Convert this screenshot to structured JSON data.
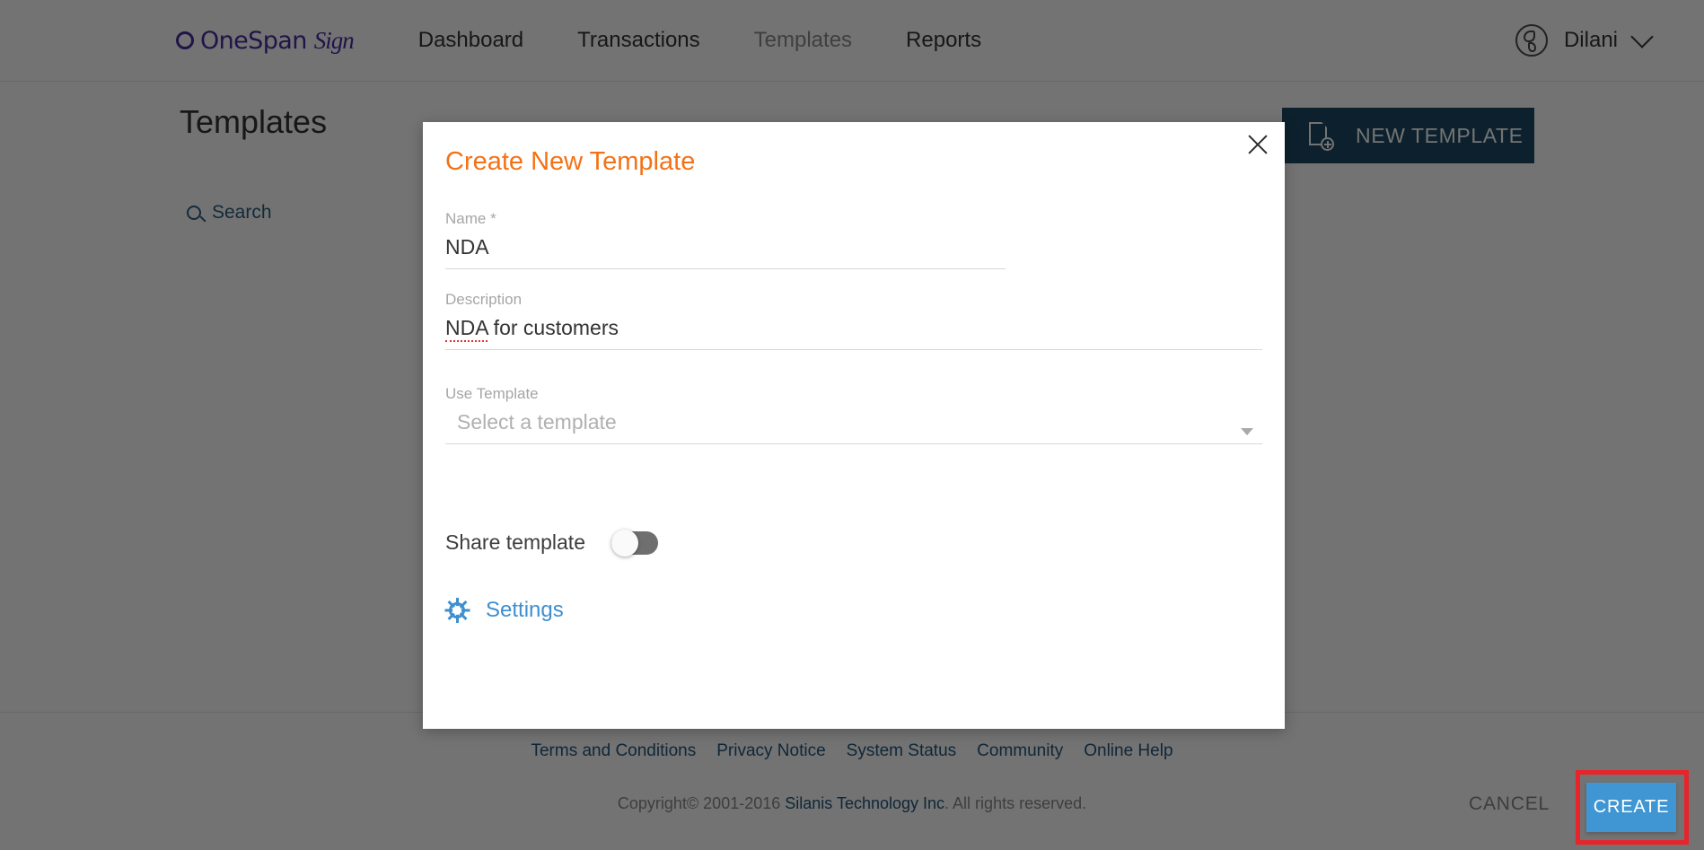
{
  "nav": {
    "brand": {
      "name_main": "OneSpan",
      "name_script": "Sign",
      "logo_icon": "onespan-ring-logo"
    },
    "links": [
      {
        "label": "Dashboard",
        "active": false
      },
      {
        "label": "Transactions",
        "active": false
      },
      {
        "label": "Templates",
        "active": true
      },
      {
        "label": "Reports",
        "active": false
      }
    ],
    "language_icon": "globe-icon",
    "user": {
      "name": "Dilani",
      "chevron_icon": "chevron-down-icon"
    }
  },
  "page": {
    "title": "Templates",
    "search": {
      "label": "Search",
      "icon": "search-icon"
    },
    "new_template_button": {
      "label": "NEW TEMPLATE",
      "icon": "document-add-icon",
      "color": "#1b4965"
    }
  },
  "modal": {
    "title": "Create New Template",
    "title_color": "#f47216",
    "close_icon": "close-icon",
    "fields": {
      "name": {
        "label": "Name *",
        "value": "NDA",
        "placeholder": ""
      },
      "description": {
        "label": "Description",
        "value_misspelled": "NDA",
        "value_rest": " for customers",
        "placeholder": ""
      },
      "use_template": {
        "label": "Use Template",
        "placeholder": "Select a template",
        "caret_icon": "chevron-down-icon"
      }
    },
    "share_template": {
      "label": "Share template",
      "enabled": false
    },
    "settings": {
      "label": "Settings",
      "icon": "gear-icon",
      "color": "#3f8fd0"
    },
    "actions": {
      "cancel_label": "CANCEL",
      "create_label": "CREATE",
      "create_color": "#3f96d2",
      "highlight_color": "#e8232a"
    }
  },
  "footer": {
    "links": [
      {
        "label": "Terms and Conditions"
      },
      {
        "label": "Privacy Notice"
      },
      {
        "label": "System Status"
      },
      {
        "label": "Community"
      },
      {
        "label": "Online Help"
      }
    ],
    "copyright_prefix": "Copyright© 2001-2016 ",
    "copyright_company": "Silanis Technology Inc",
    "copyright_suffix": ". All rights reserved."
  }
}
